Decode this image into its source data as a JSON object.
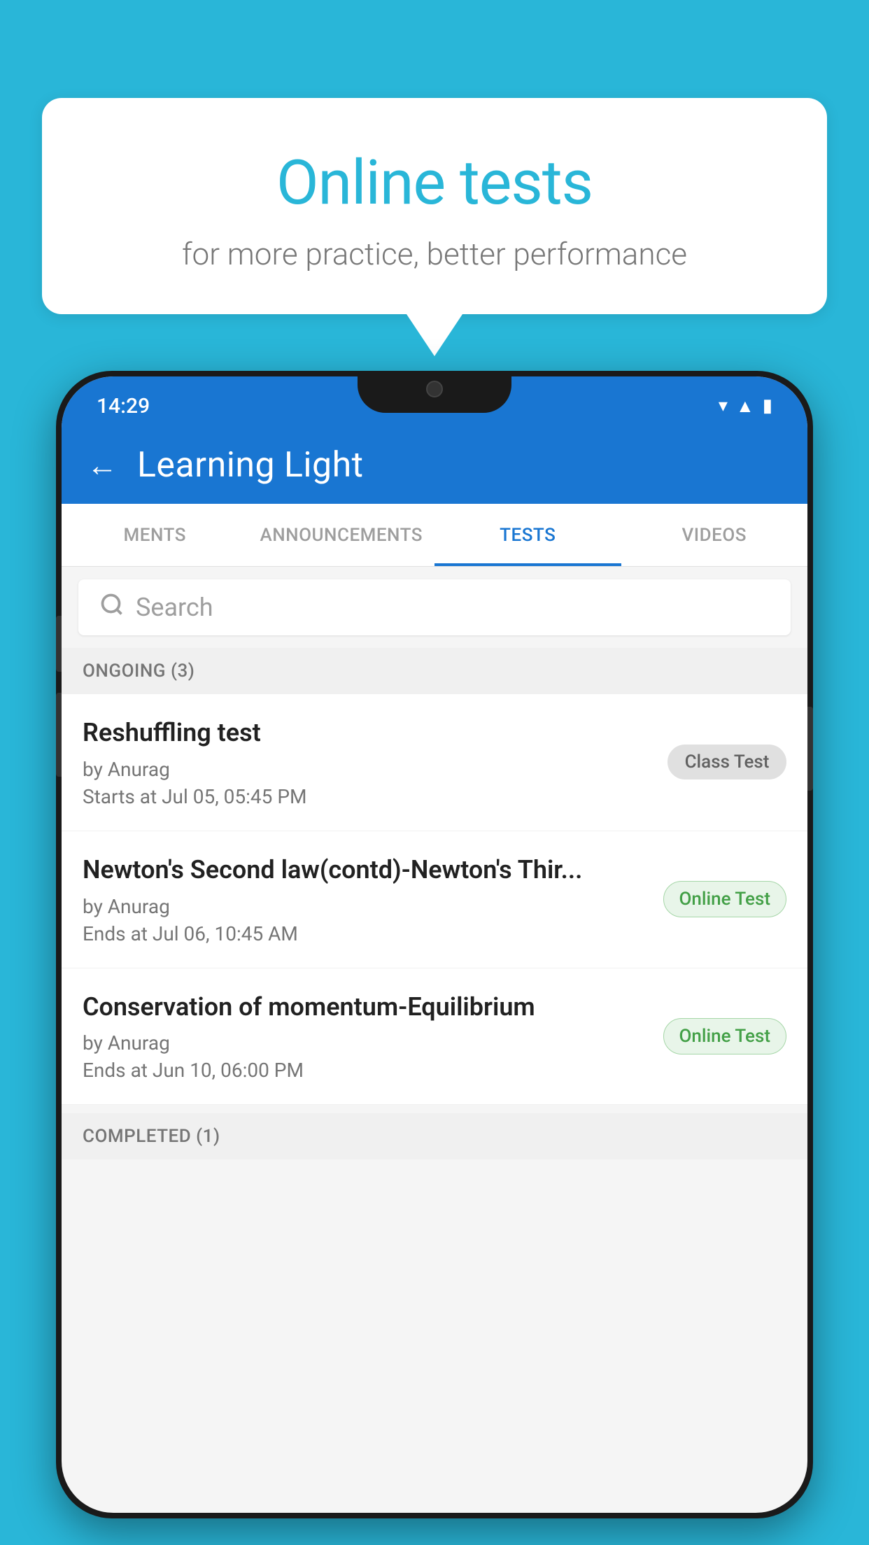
{
  "background": {
    "color": "#29b6d8"
  },
  "speech_bubble": {
    "title": "Online tests",
    "subtitle": "for more practice, better performance"
  },
  "phone": {
    "status_bar": {
      "time": "14:29",
      "icons": [
        "wifi",
        "signal",
        "battery"
      ]
    },
    "app_bar": {
      "back_label": "←",
      "title": "Learning Light"
    },
    "tabs": [
      {
        "label": "MENTS",
        "active": false
      },
      {
        "label": "ANNOUNCEMENTS",
        "active": false
      },
      {
        "label": "TESTS",
        "active": true
      },
      {
        "label": "VIDEOS",
        "active": false
      }
    ],
    "search": {
      "placeholder": "Search"
    },
    "section_ongoing": {
      "label": "ONGOING (3)"
    },
    "tests": [
      {
        "name": "Reshuffling test",
        "author": "by Anurag",
        "time": "Starts at  Jul 05, 05:45 PM",
        "badge": "Class Test",
        "badge_type": "class"
      },
      {
        "name": "Newton's Second law(contd)-Newton's Thir...",
        "author": "by Anurag",
        "time": "Ends at  Jul 06, 10:45 AM",
        "badge": "Online Test",
        "badge_type": "online"
      },
      {
        "name": "Conservation of momentum-Equilibrium",
        "author": "by Anurag",
        "time": "Ends at  Jun 10, 06:00 PM",
        "badge": "Online Test",
        "badge_type": "online"
      }
    ],
    "section_completed": {
      "label": "COMPLETED (1)"
    }
  }
}
